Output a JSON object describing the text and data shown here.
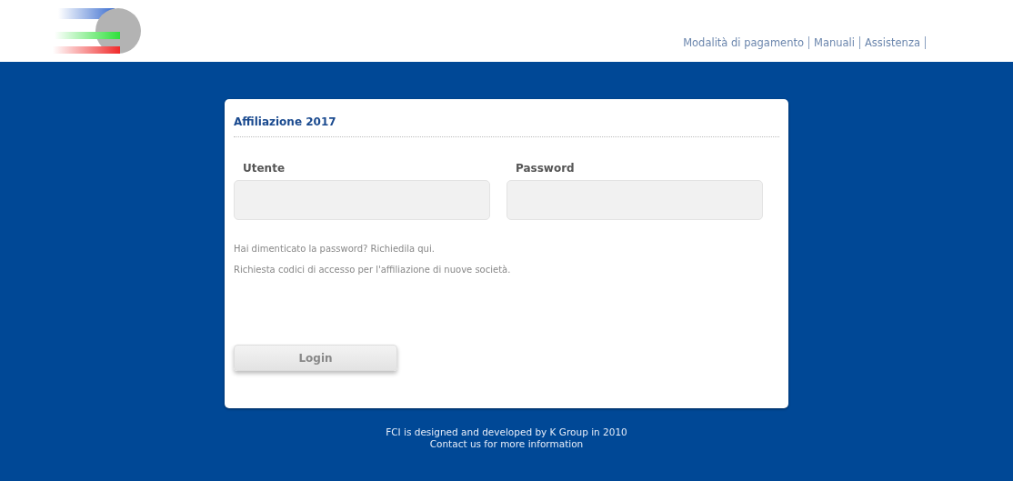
{
  "header": {
    "nav": [
      "Modalità di pagamento",
      "Manuali",
      "Assistenza"
    ]
  },
  "login": {
    "title": "Affiliazione 2017",
    "fields": [
      {
        "label": "Utente"
      },
      {
        "label": "Password"
      }
    ],
    "links": [
      "Hai dimenticato la password? Richiedila qui.",
      "Richiesta codici di accesso per l'affiliazione di nuove società."
    ],
    "button": "Login"
  },
  "footer": [
    "FCI is designed and developed by K Group in 2010",
    "Contact us for more information"
  ]
}
